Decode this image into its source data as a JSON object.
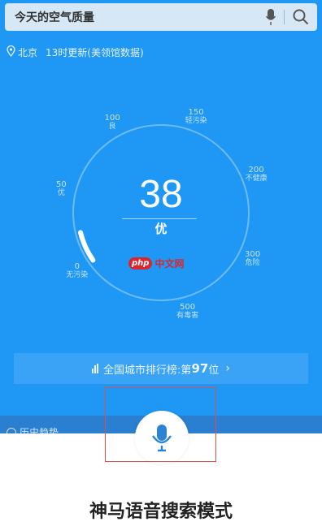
{
  "search": {
    "placeholder": "今天的空气质量"
  },
  "location": {
    "city": "北京",
    "update": "13时更新(美领馆数据)"
  },
  "gauge": {
    "value": "38",
    "level": "优",
    "value_fraction": 0.076,
    "scale": [
      {
        "num": "0",
        "desc": "无污染"
      },
      {
        "num": "50",
        "desc": "优"
      },
      {
        "num": "100",
        "desc": "良"
      },
      {
        "num": "150",
        "desc": "轻污染"
      },
      {
        "num": "200",
        "desc": "不健康"
      },
      {
        "num": "300",
        "desc": "危险"
      },
      {
        "num": "500",
        "desc": "有毒害"
      }
    ]
  },
  "watermark": {
    "brand": "php",
    "text": "中文网"
  },
  "ranking": {
    "prefix": "全国城市排行榜:第",
    "rank": "97",
    "suffix": "位",
    "chevron": "›"
  },
  "history": {
    "label": "历史趋势"
  },
  "caption": "神马语音搜索模式",
  "colors": {
    "background": "#1f97f4",
    "highlight": "#e14b4b",
    "icon": "#2b84d6"
  }
}
